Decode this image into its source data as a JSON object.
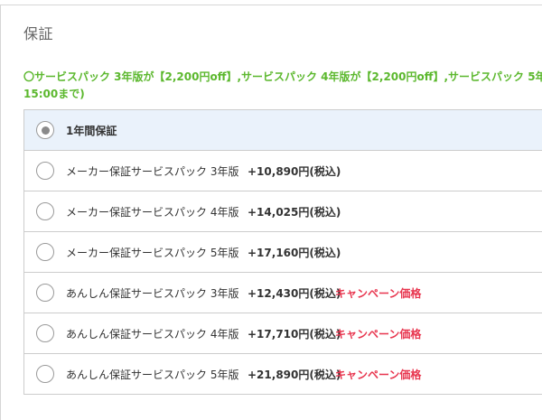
{
  "warranty": {
    "title": "保証",
    "campaign_note": {
      "line1": "〇サービスパック 3年版が【2,200円off】,サービスパック 4年版が【2,200円off】,サービスパック 5年版が",
      "line2": "15:00まで)"
    },
    "options": [
      {
        "label": "1年間保証",
        "price": "",
        "campaign": "",
        "selected": true
      },
      {
        "label": "メーカー保証サービスパック 3年版",
        "price": "+10,890円(税込)",
        "campaign": "",
        "selected": false
      },
      {
        "label": "メーカー保証サービスパック 4年版",
        "price": "+14,025円(税込)",
        "campaign": "",
        "selected": false
      },
      {
        "label": "メーカー保証サービスパック 5年版",
        "price": "+17,160円(税込)",
        "campaign": "",
        "selected": false
      },
      {
        "label": "あんしん保証サービスパック 3年版",
        "price": "+12,430円(税込)",
        "campaign": "キャンペーン価格",
        "selected": false
      },
      {
        "label": "あんしん保証サービスパック 4年版",
        "price": "+17,710円(税込)",
        "campaign": "キャンペーン価格",
        "selected": false
      },
      {
        "label": "あんしん保証サービスパック 5年版",
        "price": "+21,890円(税込)",
        "campaign": "キャンペーン価格",
        "selected": false
      }
    ]
  },
  "colors": {
    "campaign_note": "#5cb82e",
    "campaign_badge": "#e8364f",
    "selected_row_bg": "#eaf2fb",
    "border": "#cccccc"
  }
}
